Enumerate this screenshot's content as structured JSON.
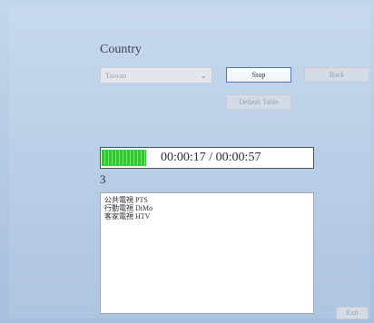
{
  "country": {
    "label": "Country",
    "selected": "Taiwan"
  },
  "buttons": {
    "stop": "Stop",
    "back": "Back",
    "default_table": "Default Table",
    "exit": "Exit"
  },
  "scan": {
    "progress_fraction": 0.3,
    "elapsed": "00:00:17 / 00:00:57",
    "count": "3"
  },
  "channels": [
    "公共電視 PTS",
    "行動電視 DiMo",
    "客家電視 HTV"
  ]
}
